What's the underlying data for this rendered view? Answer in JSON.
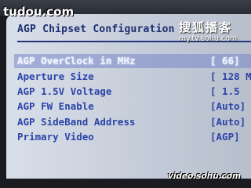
{
  "bios": {
    "title": "AGP Chipset Configuration",
    "items": [
      {
        "label": "AGP OverClock in MHz",
        "value": "[ 66]"
      },
      {
        "label": "Aperture Size",
        "value": "[ 128 M"
      },
      {
        "label": "AGP 1.5V Voltage",
        "value": "[ 1.5"
      },
      {
        "label": "AGP FW Enable",
        "value": "[Auto]"
      },
      {
        "label": "AGP SideBand Address",
        "value": "[Auto]"
      },
      {
        "label": "Primary Video",
        "value": "[AGP]"
      }
    ],
    "selected_index": 0
  },
  "watermarks": {
    "tudou": "tudou.com",
    "sohu_cn": "搜狐播客",
    "sohu_url": "my.tv.sohu.com",
    "video_sohu": "video.sohu.com"
  },
  "colors": {
    "background": "#c8cfdb",
    "text": "#2c44a8",
    "title": "#1d2e70",
    "highlight": "#f2f5ff"
  }
}
